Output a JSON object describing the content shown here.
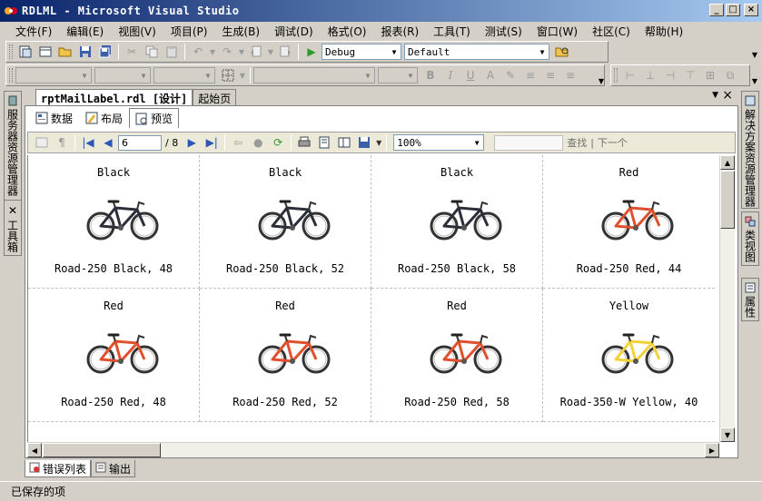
{
  "window": {
    "title": "RDLML - Microsoft Visual Studio",
    "minimize": "_",
    "maximize": "□",
    "close": "×"
  },
  "menu": [
    "文件(F)",
    "编辑(E)",
    "视图(V)",
    "项目(P)",
    "生成(B)",
    "调试(D)",
    "格式(O)",
    "报表(R)",
    "工具(T)",
    "测试(S)",
    "窗口(W)",
    "社区(C)",
    "帮助(H)"
  ],
  "toolbar": {
    "config": "Debug",
    "platform": "Default"
  },
  "side_left": {
    "server_explorer": "服务器资源管理器",
    "toolbox": "工具箱"
  },
  "side_right": {
    "solution_explorer": "解决方案资源管理器",
    "class_view": "类视图",
    "properties": "属性"
  },
  "doc_tabs": {
    "active": "rptMailLabel.rdl [设计]",
    "start_page": "起始页",
    "dropdown": "▼",
    "close": "×"
  },
  "view_tabs": [
    "数据",
    "布局",
    "预览"
  ],
  "preview": {
    "page_current": "6",
    "page_total": "/ 8",
    "zoom": "100%",
    "find": "查找",
    "find_sep": "|",
    "find_next": "下一个"
  },
  "labels": [
    {
      "color": "Black",
      "name": "Road-250 Black, 48",
      "bike_color": "#2b2f3a"
    },
    {
      "color": "Black",
      "name": "Road-250 Black, 52",
      "bike_color": "#2b2f3a"
    },
    {
      "color": "Black",
      "name": "Road-250 Black, 58",
      "bike_color": "#2b2f3a"
    },
    {
      "color": "Red",
      "name": "Road-250 Red, 44",
      "bike_color": "#e0502e"
    },
    {
      "color": "Red",
      "name": "Road-250 Red, 48",
      "bike_color": "#e0502e"
    },
    {
      "color": "Red",
      "name": "Road-250 Red, 52",
      "bike_color": "#e0502e"
    },
    {
      "color": "Red",
      "name": "Road-250 Red, 58",
      "bike_color": "#e0502e"
    },
    {
      "color": "Yellow",
      "name": "Road-350-W Yellow, 40",
      "bike_color": "#f2d23a"
    }
  ],
  "bottom_tabs": [
    "错误列表",
    "输出"
  ],
  "status": "已保存的项"
}
